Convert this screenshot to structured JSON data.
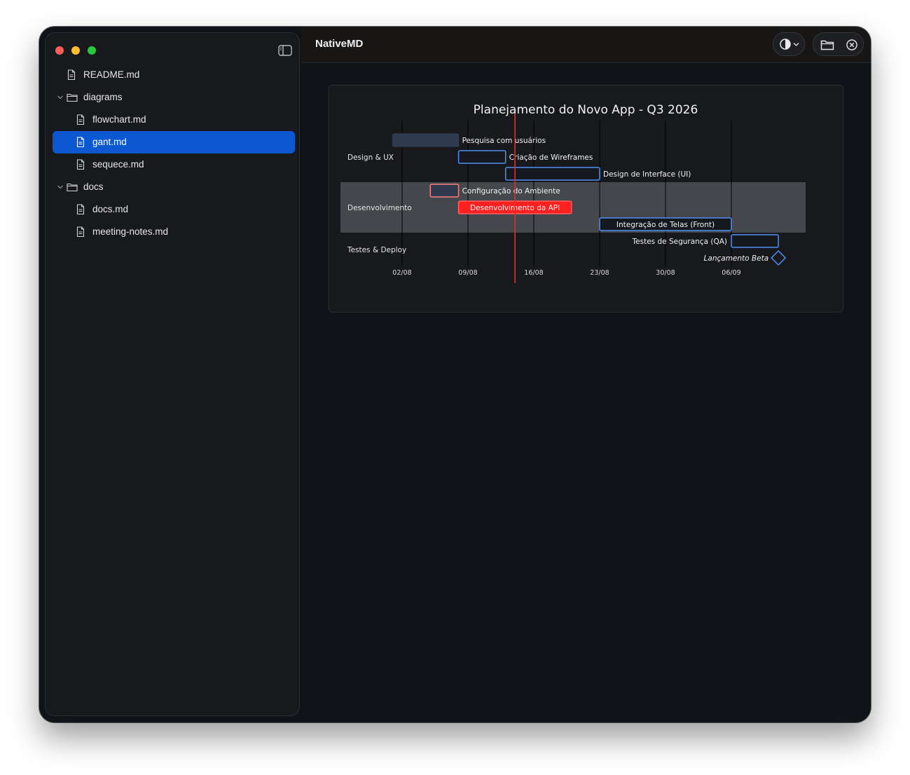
{
  "app": {
    "title": "NativeMD"
  },
  "sidebar": {
    "items": [
      {
        "label": "README.md",
        "type": "file",
        "depth": 0,
        "selected": false
      },
      {
        "label": "diagrams",
        "type": "folder",
        "depth": 0,
        "expanded": true
      },
      {
        "label": "flowchart.md",
        "type": "file",
        "depth": 1,
        "selected": false
      },
      {
        "label": "gant.md",
        "type": "file",
        "depth": 1,
        "selected": true
      },
      {
        "label": "sequece.md",
        "type": "file",
        "depth": 1,
        "selected": false
      },
      {
        "label": "docs",
        "type": "folder",
        "depth": 0,
        "expanded": true
      },
      {
        "label": "docs.md",
        "type": "file",
        "depth": 1,
        "selected": false
      },
      {
        "label": "meeting-notes.md",
        "type": "file",
        "depth": 1,
        "selected": false
      }
    ]
  },
  "toolbar": {
    "icons": [
      "contrast-icon",
      "chevron-down-icon",
      "folder-icon",
      "close-circle-icon"
    ]
  },
  "colors": {
    "accent": "#0b58d0",
    "critical": "#ff1f1f",
    "task_border": "#4f8ff7",
    "task_fill": "#2f3a4f",
    "section_highlight": "#44474c"
  },
  "chart_data": {
    "type": "gantt",
    "title": "Planejamento do Novo App - Q3 2026",
    "x_axis": {
      "ticks": [
        "02/08",
        "09/08",
        "16/08",
        "23/08",
        "30/08",
        "06/09"
      ],
      "tick_dates": [
        "2026-08-02",
        "2026-08-09",
        "2026-08-16",
        "2026-08-23",
        "2026-08-30",
        "2026-09-06"
      ]
    },
    "today_marker": "2026-08-14",
    "sections": [
      {
        "name": "Design & UX",
        "highlight": false
      },
      {
        "name": "Desenvolvimento",
        "highlight": true
      },
      {
        "name": "Testes & Deploy",
        "highlight": false
      }
    ],
    "tasks": [
      {
        "name": "Pesquisa com usuários",
        "section": 0,
        "start": "2026-08-01",
        "end": "2026-08-08",
        "status": "done"
      },
      {
        "name": "Criação de Wireframes",
        "section": 0,
        "start": "2026-08-08",
        "end": "2026-08-13",
        "status": "active"
      },
      {
        "name": "Design de Interface (UI)",
        "section": 0,
        "start": "2026-08-13",
        "end": "2026-08-23",
        "status": "active"
      },
      {
        "name": "Configuração do Ambiente",
        "section": 1,
        "start": "2026-08-05",
        "end": "2026-08-08",
        "status": "done-critical"
      },
      {
        "name": "Desenvolvimento da API",
        "section": 1,
        "start": "2026-08-08",
        "end": "2026-08-20",
        "status": "critical"
      },
      {
        "name": "Integração de Telas (Front)",
        "section": 1,
        "start": "2026-08-23",
        "end": "2026-09-06",
        "status": "active"
      },
      {
        "name": "Testes de Segurança (QA)",
        "section": 2,
        "start": "2026-09-06",
        "end": "2026-09-11",
        "status": "active"
      },
      {
        "name": "Lançamento Beta",
        "section": 2,
        "start": "2026-09-11",
        "end": "2026-09-11",
        "status": "milestone"
      }
    ]
  }
}
